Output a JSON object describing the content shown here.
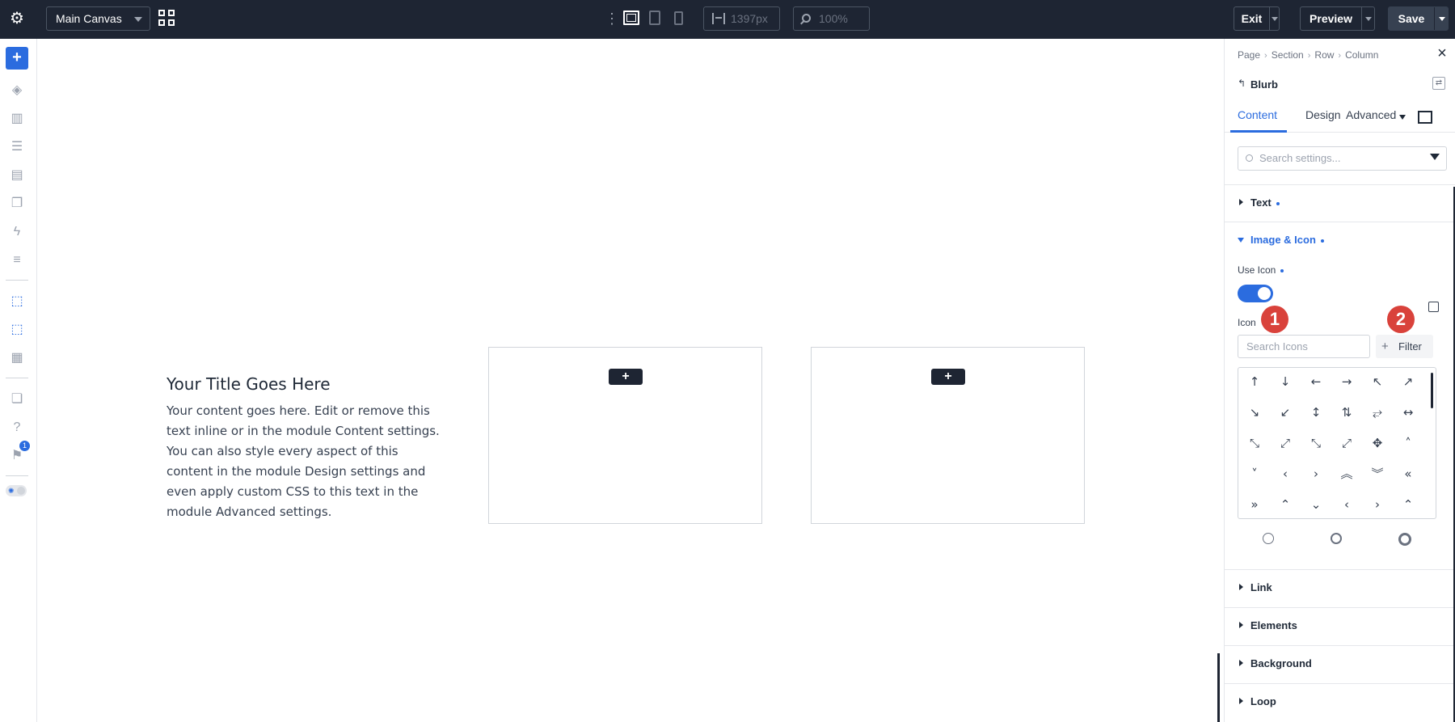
{
  "topbar": {
    "canvas_select": "Main Canvas",
    "width_value": "1397px",
    "zoom_value": "100%",
    "exit_label": "Exit",
    "preview_label": "Preview",
    "save_label": "Save"
  },
  "leftrail": {
    "notification_count": "1"
  },
  "canvas": {
    "blurb_title": "Your Title Goes Here",
    "blurb_body": "Your content goes here. Edit or remove this text inline or in the module Content settings. You can also style every aspect of this content in the module Design settings and even apply custom CSS to this text in the module Advanced settings.",
    "add_label": "+"
  },
  "panel": {
    "breadcrumb": [
      "Page",
      "Section",
      "Row",
      "Column"
    ],
    "breadcrumb_sep": "›",
    "module_back": "↰",
    "module_name": "Blurb",
    "tabs": {
      "content": "Content",
      "design": "Design",
      "advanced": "Advanced"
    },
    "search_placeholder": "Search settings...",
    "sections": {
      "text": "Text",
      "image_icon": "Image & Icon",
      "link": "Link",
      "elements": "Elements",
      "background": "Background",
      "loop": "Loop"
    },
    "use_icon_label": "Use Icon",
    "icon_label": "Icon",
    "callouts": [
      "1",
      "2"
    ],
    "icon_search_placeholder": "Search Icons",
    "filter_label": "Filter",
    "icons": [
      "↑",
      "↓",
      "←",
      "→",
      "↖",
      "↗",
      "↘",
      "↙",
      "↕",
      "⇅",
      "⥂",
      "↔",
      "⤡",
      "⤢",
      "⤡",
      "⤢",
      "✥",
      "˄",
      "˅",
      "‹",
      "›",
      "︽",
      "︾",
      "«",
      "»",
      "⌃",
      "⌄",
      "‹",
      "›",
      "⌃"
    ],
    "icon_names": [
      "arrow-up-icon",
      "arrow-down-icon",
      "arrow-left-icon",
      "arrow-right-icon",
      "arrow-up-left-icon",
      "arrow-up-right-icon",
      "arrow-down-right-icon",
      "arrow-down-left-icon",
      "arrow-up-down-icon",
      "arrows-updown-pair-icon",
      "arrows-leftright-pair-icon",
      "arrow-left-right-icon",
      "resize-diag-icon",
      "expand-diag-icon",
      "compress-diag-icon",
      "expand-diag-2-icon",
      "move-icon",
      "caret-up-icon",
      "caret-down-icon",
      "caret-left-icon",
      "caret-right-icon",
      "double-up-icon",
      "double-down-icon",
      "double-left-icon",
      "double-right-icon",
      "circle-up-icon",
      "circle-down-icon",
      "circle-left-icon",
      "circle-right-icon",
      "circle-double-up-icon"
    ]
  },
  "colors": {
    "topbar_bg": "#1e2533",
    "accent": "#2b6cdf",
    "callout": "#d9423b"
  }
}
